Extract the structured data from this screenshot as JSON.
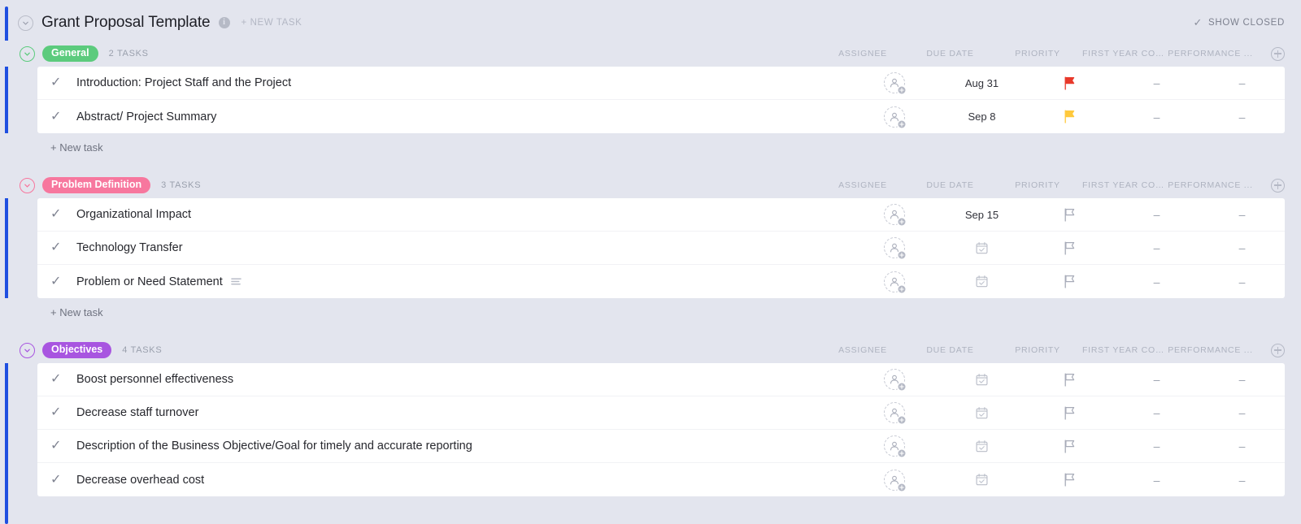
{
  "header": {
    "title": "Grant Proposal Template",
    "info_icon": "info-icon",
    "collapse_icon": "chevron-down-icon",
    "new_task_label": "+ NEW TASK",
    "show_closed_label": "SHOW CLOSED",
    "show_closed_check": "✓"
  },
  "columns": {
    "assignee": "ASSIGNEE",
    "due_date": "DUE DATE",
    "priority": "PRIORITY",
    "first_year_cost": "FIRST YEAR COS...",
    "performance": "PERFORMANCE ..."
  },
  "colors": {
    "background": "#e3e5ee",
    "card": "#ffffff",
    "rail_blue": "#1f4fe0",
    "group_general": "#5ccb7d",
    "group_problem": "#f7779e",
    "group_objectives": "#a855e0",
    "priority_urgent": "#e8392b",
    "priority_high": "#ffc93c",
    "priority_none": "#a7abb8"
  },
  "add_column_label": "+",
  "new_task_label": "+ New task",
  "empty_value": "–",
  "groups": [
    {
      "name": "General",
      "color": "#5ccb7d",
      "count_label": "2 TASKS",
      "tasks": [
        {
          "name": "Introduction: Project Staff and the Project",
          "assignee": "",
          "due_date": "Aug 31",
          "priority": "urgent",
          "first_year_cost": "–",
          "performance": "–",
          "has_description": false
        },
        {
          "name": "Abstract/ Project Summary",
          "assignee": "",
          "due_date": "Sep 8",
          "priority": "high",
          "first_year_cost": "–",
          "performance": "–",
          "has_description": false
        }
      ]
    },
    {
      "name": "Problem Definition",
      "color": "#f7779e",
      "count_label": "3 TASKS",
      "tasks": [
        {
          "name": "Organizational Impact",
          "assignee": "",
          "due_date": "Sep 15",
          "priority": "none",
          "first_year_cost": "–",
          "performance": "–",
          "has_description": false
        },
        {
          "name": "Technology Transfer",
          "assignee": "",
          "due_date": "",
          "priority": "none",
          "first_year_cost": "–",
          "performance": "–",
          "has_description": false
        },
        {
          "name": "Problem or Need Statement",
          "assignee": "",
          "due_date": "",
          "priority": "none",
          "first_year_cost": "–",
          "performance": "–",
          "has_description": true
        }
      ]
    },
    {
      "name": "Objectives",
      "color": "#a855e0",
      "count_label": "4 TASKS",
      "tasks": [
        {
          "name": "Boost personnel effectiveness",
          "assignee": "",
          "due_date": "",
          "priority": "none",
          "first_year_cost": "–",
          "performance": "–",
          "has_description": false
        },
        {
          "name": "Decrease staff turnover",
          "assignee": "",
          "due_date": "",
          "priority": "none",
          "first_year_cost": "–",
          "performance": "–",
          "has_description": false
        },
        {
          "name": "Description of the Business Objective/Goal for timely and accurate reporting",
          "assignee": "",
          "due_date": "",
          "priority": "none",
          "first_year_cost": "–",
          "performance": "–",
          "has_description": false
        },
        {
          "name": "Decrease overhead cost",
          "assignee": "",
          "due_date": "",
          "priority": "none",
          "first_year_cost": "–",
          "performance": "–",
          "has_description": false
        }
      ]
    }
  ]
}
